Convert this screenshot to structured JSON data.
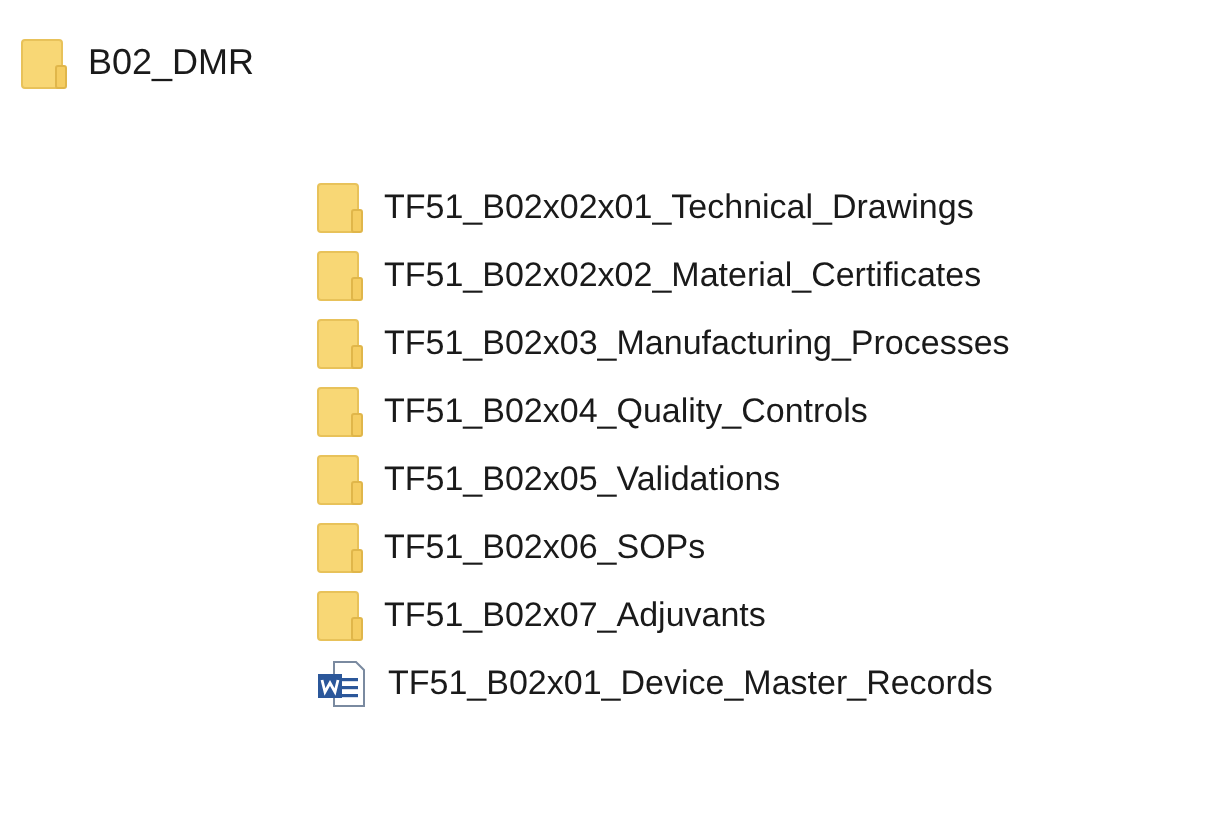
{
  "root": {
    "name": "B02_DMR",
    "kind": "folder"
  },
  "items": [
    {
      "name": "TF51_B02x02x01_Technical_Drawings",
      "kind": "folder"
    },
    {
      "name": "TF51_B02x02x02_Material_Certificates",
      "kind": "folder"
    },
    {
      "name": "TF51_B02x03_Manufacturing_Processes",
      "kind": "folder"
    },
    {
      "name": "TF51_B02x04_Quality_Controls",
      "kind": "folder"
    },
    {
      "name": "TF51_B02x05_Validations",
      "kind": "folder"
    },
    {
      "name": "TF51_B02x06_SOPs",
      "kind": "folder"
    },
    {
      "name": "TF51_B02x07_Adjuvants",
      "kind": "folder"
    },
    {
      "name": "TF51_B02x01_Device_Master_Records",
      "kind": "word-document"
    }
  ]
}
